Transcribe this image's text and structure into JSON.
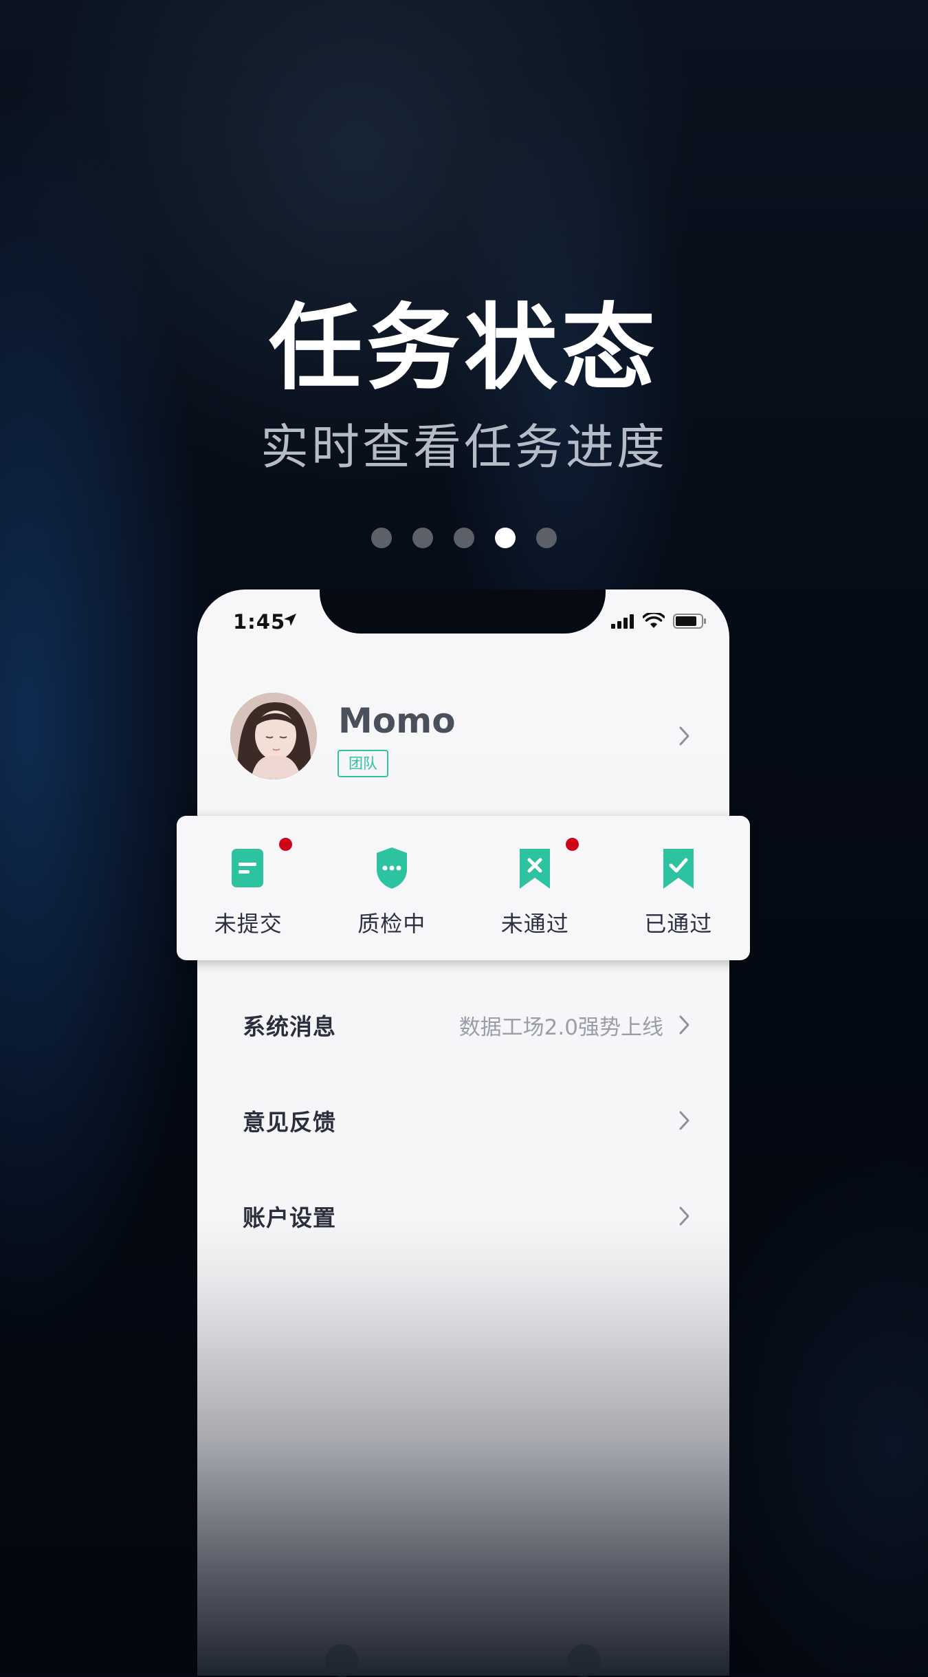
{
  "promo": {
    "title": "任务状态",
    "subtitle": "实时查看任务进度",
    "pagination": {
      "count": 5,
      "active_index": 3
    }
  },
  "status_bar": {
    "time": "1:45"
  },
  "profile": {
    "name": "Momo",
    "tag": "团队"
  },
  "task_status": [
    {
      "label": "未提交",
      "icon": "document-icon",
      "badge": true
    },
    {
      "label": "质检中",
      "icon": "shield-dots-icon",
      "badge": false
    },
    {
      "label": "未通过",
      "icon": "bookmark-x-icon",
      "badge": true
    },
    {
      "label": "已通过",
      "icon": "bookmark-check-icon",
      "badge": false
    }
  ],
  "menu": {
    "system_messages": {
      "title": "系统消息",
      "value": "数据工场2.0强势上线"
    },
    "feedback": {
      "title": "意见反馈"
    },
    "account_settings": {
      "title": "账户设置"
    }
  },
  "colors": {
    "accent": "#2dc2a0",
    "badge": "#d0021b"
  }
}
